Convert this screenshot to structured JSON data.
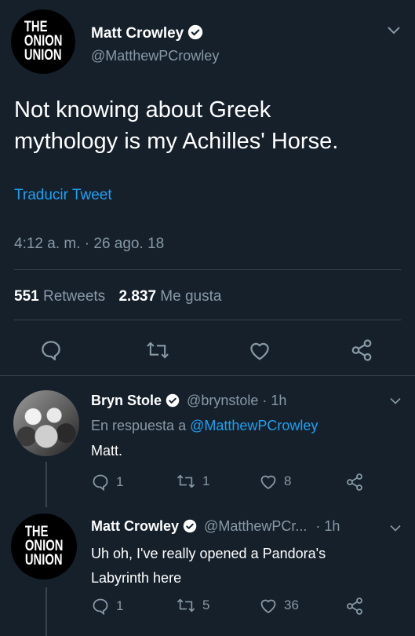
{
  "main_tweet": {
    "author": {
      "name": "Matt Crowley",
      "handle": "@MatthewPCrowley",
      "avatar_logo": "THE\nONION\nUNION"
    },
    "text_line1": "Not knowing about Greek",
    "text_line2": "mythology is my Achilles' Horse.",
    "translate_label": "Traducir Tweet",
    "timestamp": "4:12 a. m. · 26 ago. 18",
    "stats": {
      "retweets_count": "551",
      "retweets_label": "Retweets",
      "likes_count": "2.837",
      "likes_label": "Me gusta"
    },
    "actions": [
      "reply-icon",
      "retweet-icon",
      "like-icon",
      "share-icon"
    ]
  },
  "replies": [
    {
      "name": "Bryn Stole",
      "handle": "@brynstole",
      "time": "· 1h",
      "reply_to_prefix": "En respuesta a",
      "reply_to_handle": "@MatthewPCrowley",
      "text": "Matt.",
      "reply_count": "1",
      "retweet_count": "1",
      "like_count": "8"
    },
    {
      "name": "Matt Crowley",
      "handle": "@MatthewPCr...",
      "time": "· 1h",
      "avatar_logo": "THE\nONION\nUNION",
      "text_line1": "Uh oh, I've really opened a Pandora's",
      "text_line2": "Labyrinth here",
      "reply_count": "1",
      "retweet_count": "5",
      "like_count": "36"
    }
  ],
  "colors": {
    "background": "#15202b",
    "accent": "#1da1f2",
    "muted": "#8899a6",
    "divider": "#38444d"
  }
}
